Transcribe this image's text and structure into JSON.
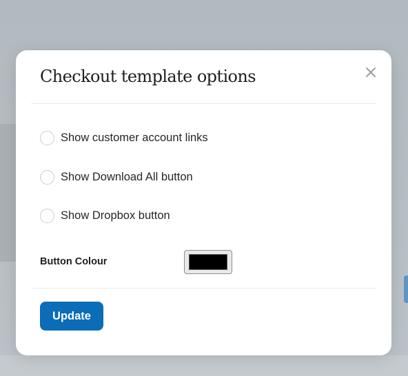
{
  "modal": {
    "title": "Checkout template options",
    "close_icon": "close-icon",
    "options": [
      {
        "label": "Show customer account links",
        "checked": false
      },
      {
        "label": "Show Download All button",
        "checked": false
      },
      {
        "label": "Show Dropbox button",
        "checked": false
      }
    ],
    "button_colour_label": "Button Colour",
    "button_colour_value": "#000000",
    "update_label": "Update"
  },
  "colors": {
    "accent": "#0b6cb7",
    "overlay": "#b8c0c5"
  }
}
